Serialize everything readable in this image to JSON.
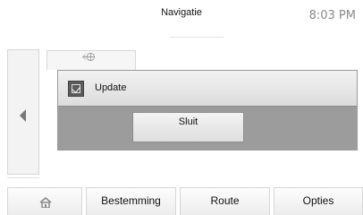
{
  "header": {
    "title": "Navigatie",
    "time": "8:03 PM"
  },
  "dialog": {
    "title": "Update",
    "close_label": "Sluit"
  },
  "nav": {
    "home_icon": "home-icon",
    "items": [
      "Bestemming",
      "Route",
      "Opties"
    ]
  },
  "icons": {
    "back": "chevron-left-icon",
    "update": "update-icon",
    "navigation": "navigation-icon"
  }
}
